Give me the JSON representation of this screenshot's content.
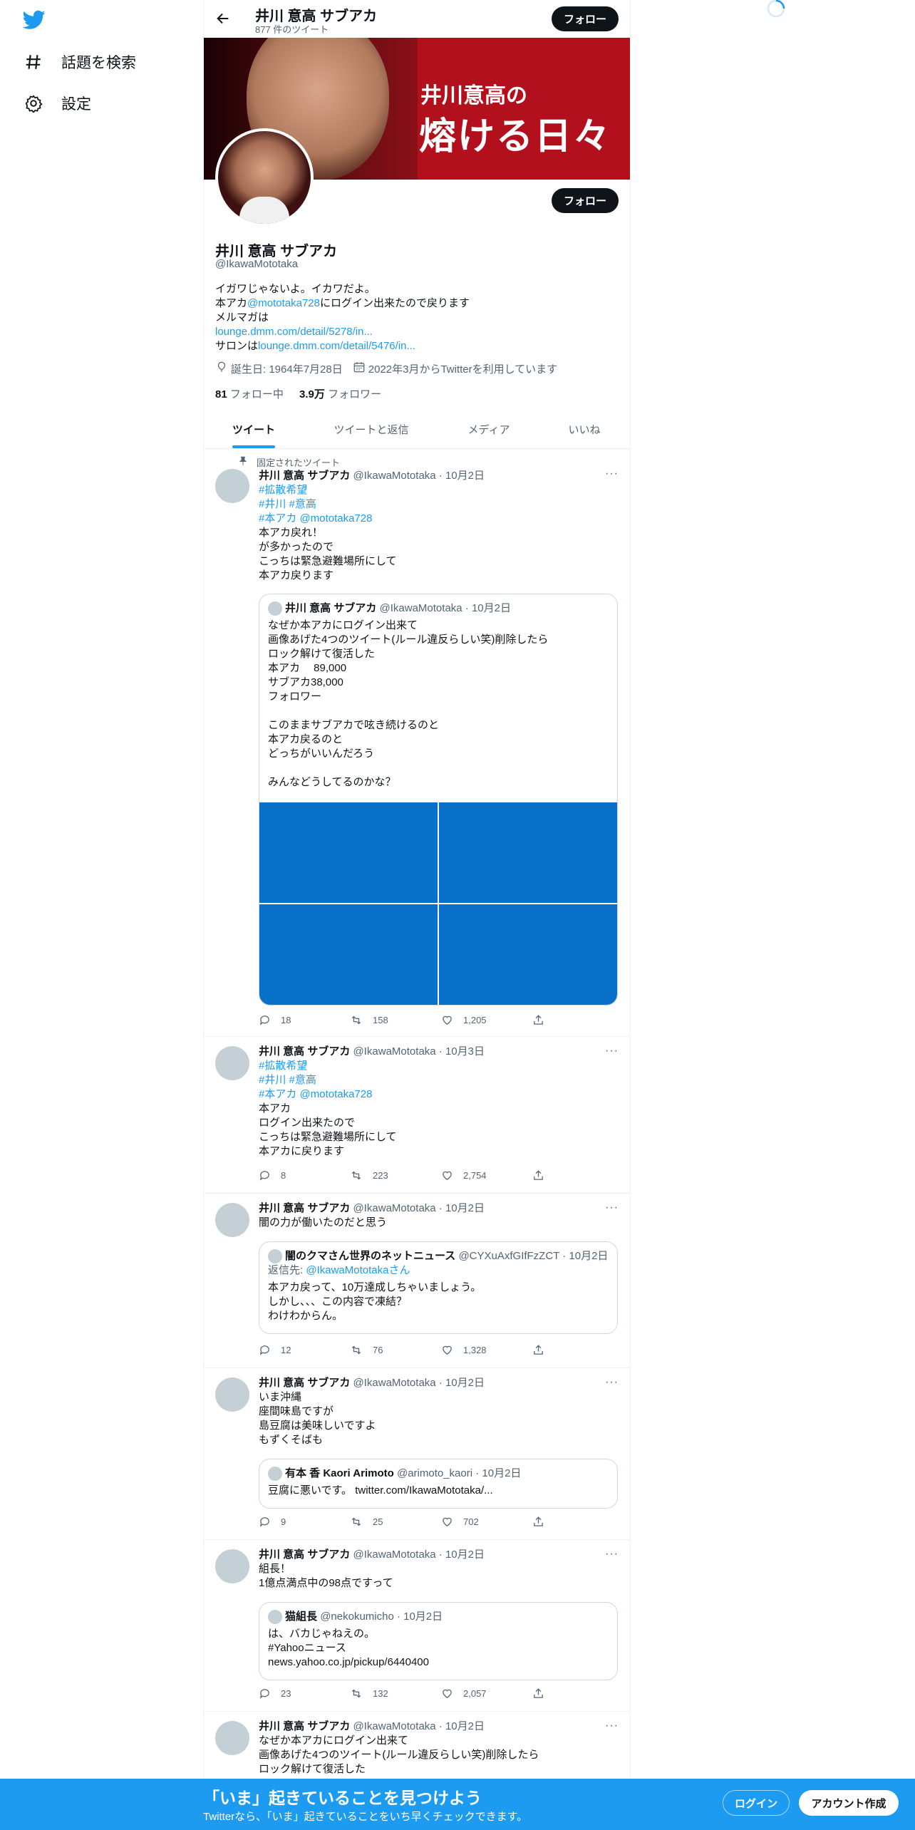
{
  "nav": {
    "explore_label": "話題を検索",
    "settings_label": "設定"
  },
  "header": {
    "title": "井川 意高 サブアカ",
    "tweet_count": "877 件のツイート",
    "follow_label": "フォロー"
  },
  "banner": {
    "line1": "井川意高の",
    "line2": "熔ける日々"
  },
  "profile": {
    "follow_label": "フォロー",
    "name": "井川 意高 サブアカ",
    "handle": "@IkawaMototaka",
    "bio_line1": "イガワじゃないよ。イカワだよ。",
    "bio_line2_pre": "本アカ",
    "bio_line2_link": "@mototaka728",
    "bio_line2_post": "にログイン出来たので戻ります",
    "bio_line3": "メルマガは",
    "bio_line4_link": "lounge.dmm.com/detail/5278/in...",
    "bio_line5_pre": "サロンは",
    "bio_line5_link": "lounge.dmm.com/detail/5476/in...",
    "birthday": "誕生日: 1964年7月28日",
    "joined": "2022年3月からTwitterを利用しています",
    "following_count": "81",
    "following_label": "フォロー中",
    "followers_count": "3.9万",
    "followers_label": "フォロワー"
  },
  "tabs": [
    "ツイート",
    "ツイートと返信",
    "メディア",
    "いいね"
  ],
  "pinned_label": "固定されたツイート",
  "tweets": [
    {
      "name": "井川 意高 サブアカ",
      "meta": "@IkawaMototaka · 10月2日",
      "hashtags1": "#拡散希望",
      "hashtags2": "#井川 #意高",
      "hashtags3": "#本アカ @mototaka728",
      "text": "本アカ戻れ！\nが多かったので\nこっちは緊急避難場所にして\n本アカ戻ります",
      "quote_name": "井川 意高 サブアカ",
      "quote_meta": "@IkawaMototaka · 10月2日",
      "quote_text": "なぜか本アカにログイン出来て\n画像あげた4つのツイート(ルール違反らしい笑)削除したら\nロック解けて復活した\n本アカ　 89,000\nサブアカ38,000\nフォロワー\n\nこのままサブアカで呟き続けるのと\n本アカ戻るのと\nどっちがいいんだろう\n\nみんなどうしてるのかな？",
      "replies": "18",
      "retweets": "158",
      "likes": "1,205"
    },
    {
      "name": "井川 意高 サブアカ",
      "meta": "@IkawaMototaka · 10月3日",
      "hashtags1": "#拡散希望",
      "hashtags2": "#井川 #意高",
      "hashtags3": "#本アカ @mototaka728",
      "text": "本アカ\nログイン出来たので\nこっちは緊急避難場所にして\n本アカに戻ります",
      "replies": "8",
      "retweets": "223",
      "likes": "2,754"
    },
    {
      "name": "井川 意高 サブアカ",
      "meta": "@IkawaMototaka · 10月2日",
      "text": "闇の力が働いたのだと思う",
      "quote_name": "闇のクマさん世界のネットニュース",
      "quote_meta": "@CYXuAxfGIfFzZCT · 10月2日",
      "quote_reply_pre": "返信先: ",
      "quote_reply_link": "@IkawaMototakaさん",
      "quote_text": "本アカ戻って、10万達成しちゃいましょう。\nしかし、、、この内容で凍結？\nわけわからん。",
      "replies": "12",
      "retweets": "76",
      "likes": "1,328"
    },
    {
      "name": "井川 意高 サブアカ",
      "meta": "@IkawaMototaka · 10月2日",
      "text": "いま沖縄\n座間味島ですが\n島豆腐は美味しいですよ\nもずくそばも",
      "quote_name": "有本 香 Kaori Arimoto",
      "quote_meta": "@arimoto_kaori · 10月2日",
      "quote_text": "豆腐に悪いです。 twitter.com/IkawaMototaka/...",
      "replies": "9",
      "retweets": "25",
      "likes": "702"
    },
    {
      "name": "井川 意高 サブアカ",
      "meta": "@IkawaMototaka · 10月2日",
      "text": "組長！\n1億点満点中の98点ですって",
      "quote_name": "猫組長",
      "quote_meta": "@nekokumicho · 10月2日",
      "quote_text": "は、バカじゃねえの。\n#Yahooニュース\nnews.yahoo.co.jp/pickup/6440400",
      "replies": "23",
      "retweets": "132",
      "likes": "2,057"
    },
    {
      "name": "井川 意高 サブアカ",
      "meta": "@IkawaMototaka · 10月2日",
      "text": "なぜか本アカにログイン出来て\n画像あげた4つのツイート(ルール違反らしい笑)削除したら\nロック解けて復活した"
    }
  ],
  "bottom_bar": {
    "headline": "「いま」起きていることを見つけよう",
    "subtext": "Twitterなら、「いま」起きていることをいち早くチェックできます。",
    "login_label": "ログイン",
    "signup_label": "アカウント作成"
  },
  "colors": {
    "accent": "#1d9bf0",
    "banner": "#b3101d",
    "media": "#0870c8"
  }
}
